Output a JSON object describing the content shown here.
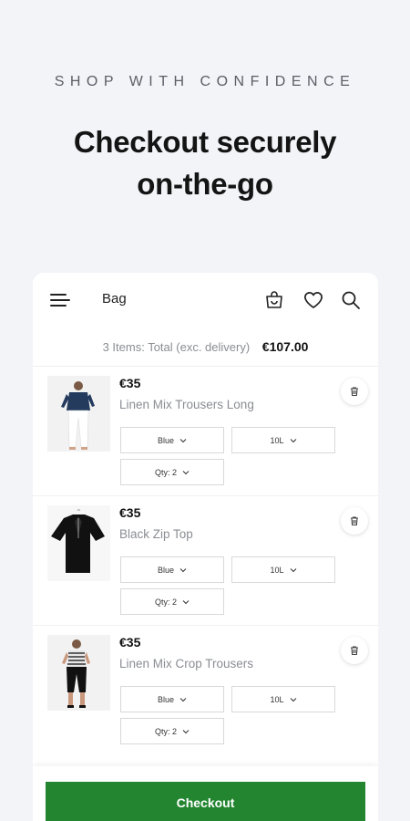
{
  "promo": {
    "tagline": "SHOP WITH CONFIDENCE",
    "headline_line1": "Checkout securely",
    "headline_line2": "on-the-go"
  },
  "appbar": {
    "title": "Bag",
    "icons": [
      "menu-icon",
      "bag-icon",
      "heart-icon",
      "search-icon"
    ]
  },
  "summary": {
    "label": "3 Items: Total (exc. delivery)",
    "total": "€107.00"
  },
  "items": [
    {
      "price": "€35",
      "name": "Linen Mix Trousers Long",
      "colour": "Blue",
      "size": "10L",
      "qty": "Qty: 2"
    },
    {
      "price": "€35",
      "name": "Black Zip Top",
      "colour": "Blue",
      "size": "10L",
      "qty": "Qty: 2"
    },
    {
      "price": "€35",
      "name": "Linen Mix Crop Trousers",
      "colour": "Blue",
      "size": "10L",
      "qty": "Qty: 2"
    }
  ],
  "checkout": {
    "label": "Checkout"
  },
  "colors": {
    "accent": "#238530",
    "background": "#f3f4f8"
  }
}
